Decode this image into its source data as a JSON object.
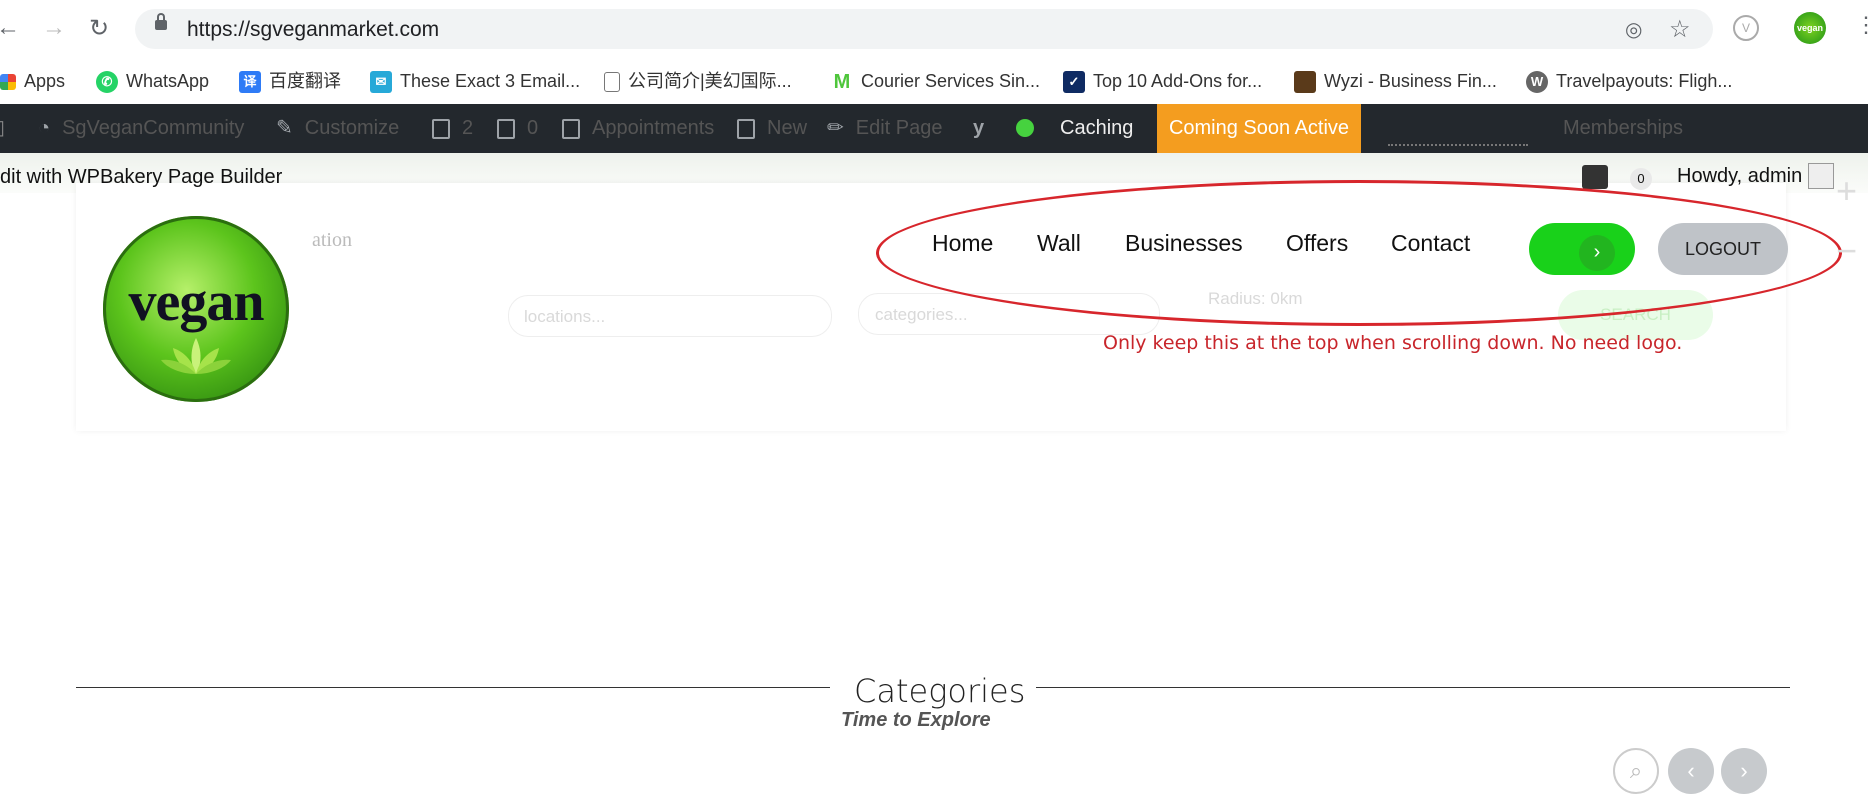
{
  "browser": {
    "url": "https://sgveganmarket.com",
    "back_icon": "←",
    "forward_icon": "→",
    "reload_icon": "↻",
    "star_icon": "☆",
    "profile_label": "vegan",
    "bookmarks": [
      {
        "label": "Apps",
        "icon": "apps-grid"
      },
      {
        "label": "WhatsApp",
        "icon": "whatsapp"
      },
      {
        "label": "百度翻译",
        "icon": "translate"
      },
      {
        "label": "These Exact 3 Email...",
        "icon": "mail"
      },
      {
        "label": "公司简介|美幻国际...",
        "icon": "page"
      },
      {
        "label": "Courier Services Sin...",
        "icon": "m-logo"
      },
      {
        "label": "Top 10 Add-Ons for...",
        "icon": "check"
      },
      {
        "label": "Wyzi - Business Fin...",
        "icon": "wyzi"
      },
      {
        "label": "Travelpayouts: Fligh...",
        "icon": "wordpress"
      }
    ]
  },
  "adminbar": {
    "site": "SgVeganCommunity",
    "customize": "Customize",
    "updates": "2",
    "comments": "0",
    "appointments": "Appointments",
    "new": "New",
    "edit_page": "Edit Page",
    "caching": "Caching",
    "coming_soon": "Coming Soon Active",
    "memberships": "Memberships",
    "edit_with": "dit with WPBakery Page Builder",
    "howdy": "Howdy, admin",
    "comment_count": "0"
  },
  "header": {
    "logo_text": "vegan",
    "nav": [
      "Home",
      "Wall",
      "Businesses",
      "Offers",
      "Contact"
    ],
    "toggle_arrow": "›",
    "logout": "LOGOUT",
    "ghost_location": "ation",
    "ghost_locations_placeholder": "locations...",
    "ghost_categories_placeholder": "categories...",
    "ghost_radius": "Radius: 0km",
    "ghost_search": "SEARCH"
  },
  "annotation": {
    "note": "Only keep this at the top when scrolling down. No need logo."
  },
  "categories": {
    "title": "Categories",
    "subtitle": "Time to Explore",
    "search_icon": "⌕",
    "prev": "‹",
    "next": "›"
  },
  "colors": {
    "adminbar": "#23282d",
    "coming_soon": "#f49d1f",
    "toggle": "#19d11a",
    "annotation": "#d7262c"
  }
}
